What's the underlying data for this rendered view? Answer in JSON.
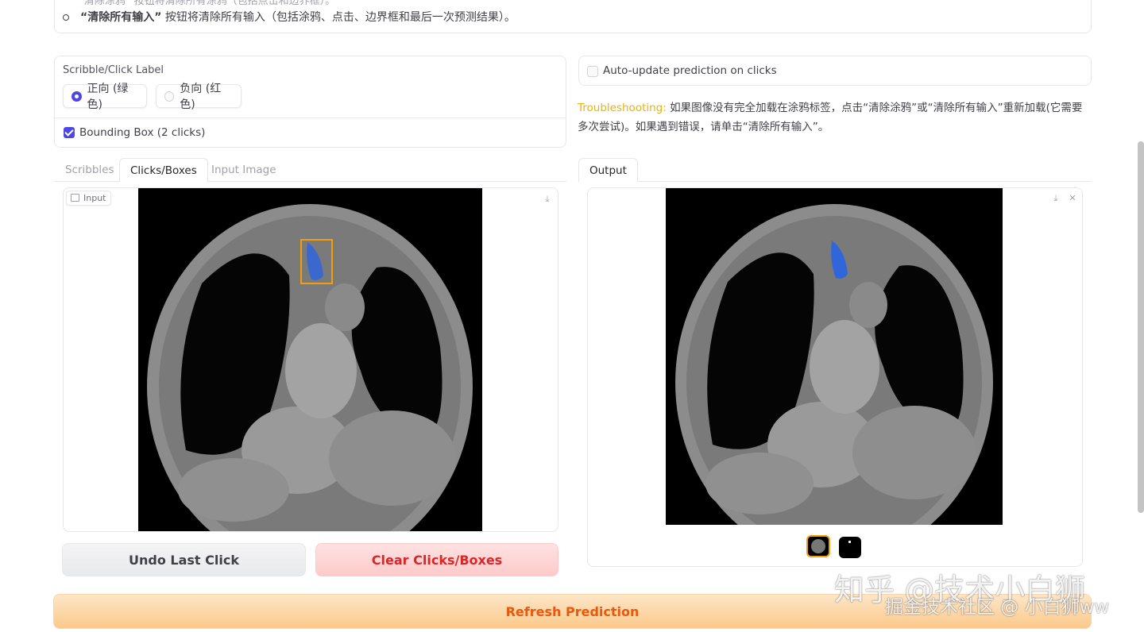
{
  "notes": {
    "line1_fragment": "“清除涂鸦” 按钮将清除所有涂鸦（包括点击和边界框）。",
    "line2_bold": "“清除所有输入”",
    "line2_rest": " 按钮将清除所有输入（包括涂鸦、点击、边界框和最后一次预测结果）。"
  },
  "label_panel": {
    "title": "Scribble/Click Label",
    "options": [
      "正向 (绿色)",
      "负向 (红色)"
    ],
    "selected": "正向 (绿色)",
    "bbox_label": "Bounding Box (2 clicks)",
    "bbox_checked": true
  },
  "auto_update": {
    "label": "Auto-update prediction on clicks",
    "checked": false
  },
  "troubleshooting": {
    "label": "Troubleshooting:",
    "text": " 如果图像没有完全加载在涂鸦标签，点击“清除涂鸦”或“清除所有输入”重新加载(它需要多次尝试)。如果遇到错误，请单击“清除所有输入”。"
  },
  "input_tabs": [
    "Scribbles",
    "Clicks/Boxes",
    "Input Image"
  ],
  "active_input_tab": "Clicks/Boxes",
  "input_image": {
    "label": "Input"
  },
  "output_tabs": [
    "Output"
  ],
  "buttons": {
    "undo": "Undo Last Click",
    "clear": "Clear Clicks/Boxes",
    "refresh": "Refresh Prediction"
  },
  "icons": {
    "download": "download-icon",
    "close": "close-icon",
    "image": "image-icon"
  },
  "colors": {
    "accent": "#4f46e5",
    "troubleshooting": "#eab308",
    "clear_text": "#dc2626",
    "refresh_text": "#ea580c",
    "box_outline": "#f59e0b",
    "segmentation": "#2563eb"
  },
  "watermarks": [
    "知乎 @技术小白狮",
    "掘金技术社区 @ 小白狮ww"
  ]
}
